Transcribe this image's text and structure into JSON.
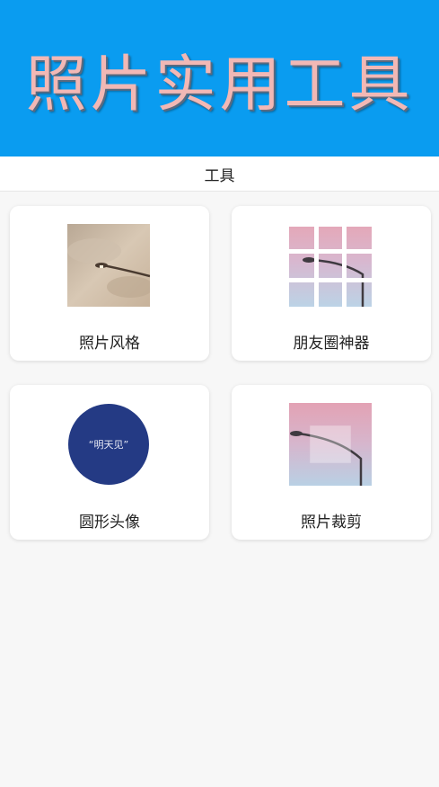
{
  "banner": {
    "title": "照片实用工具"
  },
  "header": {
    "title": "工具"
  },
  "tools": [
    {
      "label": "照片风格",
      "icon": "sepia-streetlamp-photo-icon"
    },
    {
      "label": "朋友圈神器",
      "icon": "grid-split-photo-icon"
    },
    {
      "label": "圆形头像",
      "icon": "circle-avatar-icon",
      "avatar_text": "“明天见”"
    },
    {
      "label": "照片裁剪",
      "icon": "crop-photo-icon"
    }
  ],
  "colors": {
    "banner_bg": "#0a9cf0",
    "banner_text": "#f2b8b5",
    "avatar_bg": "#243a84"
  }
}
